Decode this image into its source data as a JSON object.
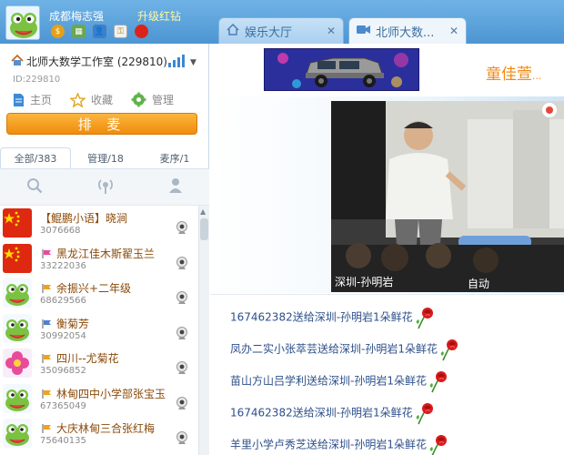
{
  "user": {
    "name": "成都梅志强",
    "upgrade": "升级红钻"
  },
  "tabs": [
    {
      "label": "娱乐大厅",
      "close": "✕"
    },
    {
      "label": "北师大数...",
      "close": "✕"
    }
  ],
  "room": {
    "name": "北师大数学工作室 (229810)",
    "id_text": "ID:229810"
  },
  "nav": {
    "home": "主页",
    "favorite": "收藏",
    "manage": "管理"
  },
  "queue_button": "排 麦",
  "list_tabs": [
    {
      "label": "全部/383",
      "active": true
    },
    {
      "label": "管理/18",
      "active": false
    },
    {
      "label": "麦序/1",
      "active": false
    }
  ],
  "users": [
    {
      "name": "【鲲鹏小语】晓涧",
      "id": "3076668",
      "avatar": "china-flag",
      "flag": "",
      "name_color": "#8b4a08"
    },
    {
      "name": "黑龙江佳木斯翟玉兰",
      "id": "33222036",
      "avatar": "china-flag",
      "flag": "#e84b9a",
      "name_color": "#8b4a08"
    },
    {
      "name": "余振兴+二年级",
      "id": "68629566",
      "avatar": "frog",
      "flag": "#f0a020",
      "name_color": "#8b4a08"
    },
    {
      "name": "衡菊芳",
      "id": "30992054",
      "avatar": "frog",
      "flag": "#4f7fcf",
      "name_color": "#8b4a08"
    },
    {
      "name": "四川--尤菊花",
      "id": "35096852",
      "avatar": "flower",
      "flag": "#f0a020",
      "name_color": "#8b4a08"
    },
    {
      "name": "林甸四中小学部张宝玉",
      "id": "67365049",
      "avatar": "frog",
      "flag": "#f0a020",
      "name_color": "#8b4a08"
    },
    {
      "name": "大庆林甸三合张红梅",
      "id": "75640135",
      "avatar": "frog",
      "flag": "#f0a020",
      "name_color": "#8b4a08"
    }
  ],
  "host": {
    "name": "童佳萱",
    "dots": "..."
  },
  "video": {
    "caption": "深圳-孙明岩",
    "mode": "自动"
  },
  "chat": [
    "167462382送给深圳-孙明岩1朵鲜花",
    "凤办二实小张萃芸送给深圳-孙明岩1朵鲜花",
    "苗山方山吕学利送给深圳-孙明岩1朵鲜花",
    "167462382送给深圳-孙明岩1朵鲜花",
    "羊里小学卢秀芝送给深圳-孙明岩1朵鲜花"
  ],
  "colors": {
    "topbar": "#5aa3dc",
    "accent_orange": "#f28a16",
    "chat_text": "#2c4f8a"
  }
}
